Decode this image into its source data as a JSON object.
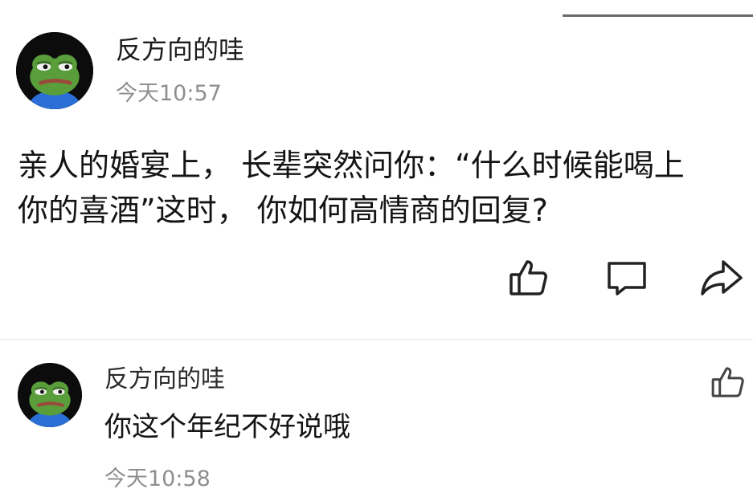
{
  "post": {
    "author": "反方向的哇",
    "time": "今天10:57",
    "body_line1": "亲人的婚宴上， 长辈突然问你：“什么时候能喝上",
    "body_line2": "你的喜酒”这时， 你如何高情商的回复?",
    "avatar_icon": "frog-avatar-icon",
    "actions": {
      "like_icon": "thumbs-up-icon",
      "comment_icon": "comment-icon",
      "share_icon": "share-icon"
    }
  },
  "reply": {
    "author": "反方向的哇",
    "text": "你这个年纪不好说哦",
    "time": "今天10:58",
    "avatar_icon": "frog-avatar-icon",
    "like_icon": "thumbs-up-icon"
  },
  "colors": {
    "text": "#141414",
    "meta": "#8e8e8e",
    "divider": "#f0f0f0",
    "frog_green": "#5a9e3c",
    "frog_shirt": "#2b6fd6"
  }
}
